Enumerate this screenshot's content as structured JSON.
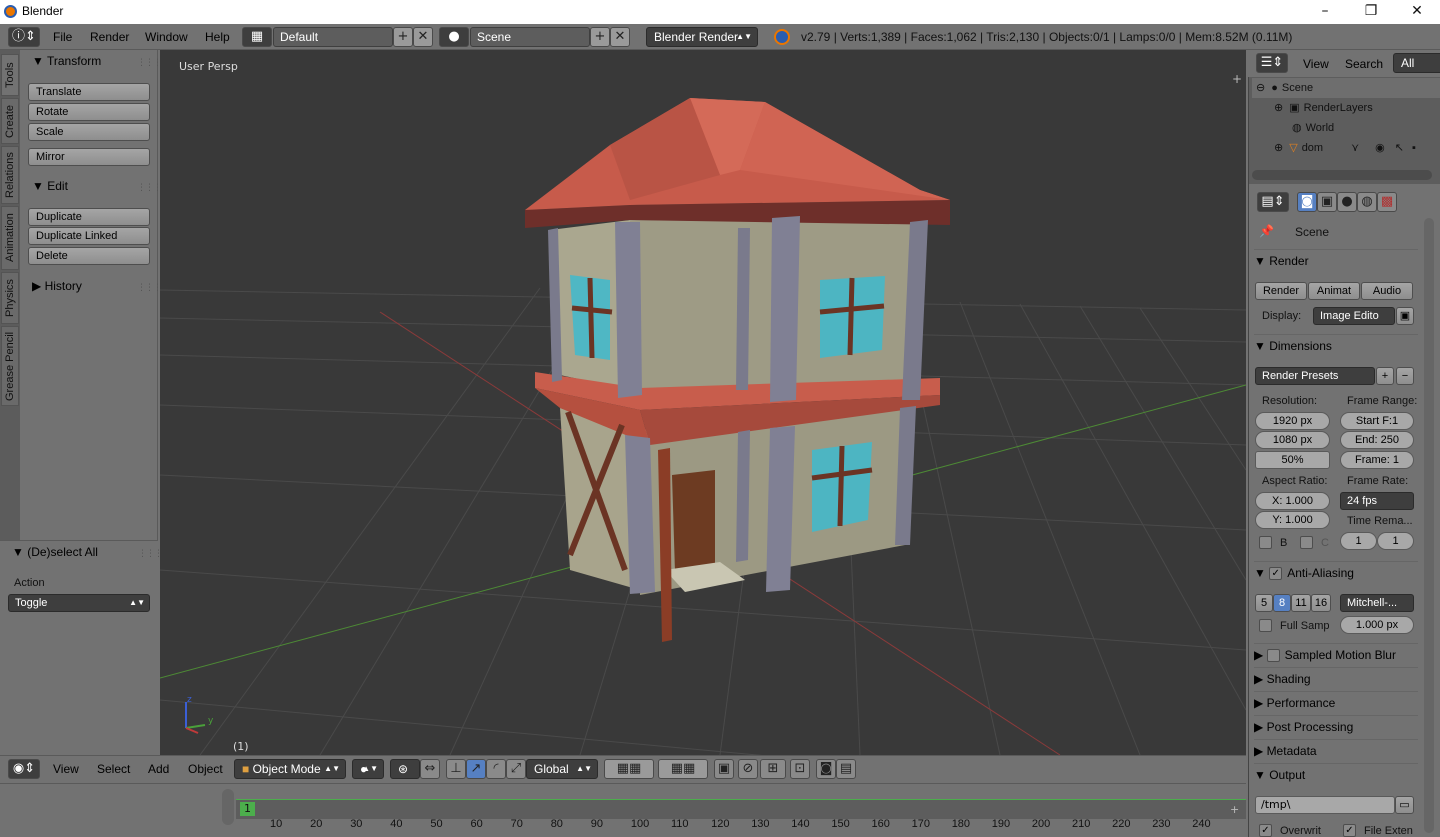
{
  "window": {
    "title": "Blender",
    "minimize": "–",
    "maximize": "❐",
    "close": "✕"
  },
  "menu": {
    "file": "File",
    "render": "Render",
    "window": "Window",
    "help": "Help"
  },
  "screen_layout": "Default",
  "scene_name": "Scene",
  "render_engine": "Blender Render",
  "stats": "v2.79 | Verts:1,389 | Faces:1,062 | Tris:2,130 | Objects:0/1 | Lamps:0/0 | Mem:8.52M (0.11M)",
  "shelf_tabs": [
    "Tools",
    "Create",
    "Relations",
    "Animation",
    "Physics",
    "Grease Pencil"
  ],
  "transform": {
    "header": "Transform",
    "translate": "Translate",
    "rotate": "Rotate",
    "scale": "Scale",
    "mirror": "Mirror"
  },
  "edit": {
    "header": "Edit",
    "duplicate": "Duplicate",
    "duplicate_linked": "Duplicate Linked",
    "delete": "Delete"
  },
  "history": {
    "header": "History"
  },
  "operator": {
    "header": "(De)select All",
    "action_label": "Action",
    "action_value": "Toggle"
  },
  "viewport": {
    "label": "User Persp",
    "frame": "(1)",
    "axis_x": "x",
    "axis_y": "y",
    "axis_z": "z"
  },
  "view_header": {
    "view": "View",
    "select": "Select",
    "add": "Add",
    "object": "Object",
    "mode": "Object Mode",
    "orientation": "Global"
  },
  "timeline": {
    "current": "1",
    "ticks": [
      "10",
      "20",
      "30",
      "40",
      "50",
      "60",
      "70",
      "80",
      "90",
      "100",
      "110",
      "120",
      "130",
      "140",
      "150",
      "160",
      "170",
      "180",
      "190",
      "200",
      "210",
      "220",
      "230",
      "240"
    ]
  },
  "outliner": {
    "view": "View",
    "search": "Search",
    "filter": "All Scen",
    "items": [
      "Scene",
      "RenderLayers",
      "World",
      "dom"
    ]
  },
  "properties": {
    "scene": "Scene",
    "render_header": "Render",
    "render_btn": "Render",
    "anim_btn": "Animat",
    "audio_btn": "Audio",
    "display_label": "Display:",
    "display_value": "Image Edito",
    "dimensions": "Dimensions",
    "presets": "Render Presets",
    "resolution_label": "Resolution:",
    "res_x": "1920 px",
    "res_y": "1080 px",
    "res_pct": "50%",
    "frame_range_label": "Frame Range:",
    "start": "Start F:1",
    "end": "End: 250",
    "frame": "Frame: 1",
    "aspect_label": "Aspect Ratio:",
    "aspect_x": "X: 1.000",
    "aspect_y": "Y: 1.000",
    "frame_rate_label": "Frame Rate:",
    "fps": "24 fps",
    "time_remap": "Time Rema...",
    "remap_old": "1",
    "remap_new": "1",
    "border_b": "B",
    "border_c": "C",
    "anti_aliasing": "Anti-Aliasing",
    "aa_samples": [
      "5",
      "8",
      "11",
      "16"
    ],
    "filter": "Mitchell-...",
    "full_sample": "Full Samp",
    "filter_size": "1.000 px",
    "motion_blur": "Sampled Motion Blur",
    "shading": "Shading",
    "performance": "Performance",
    "post_processing": "Post Processing",
    "metadata": "Metadata",
    "output": "Output",
    "output_path": "/tmp\\",
    "overwrite": "Overwrit",
    "file_ext": "File Exten"
  },
  "colors": {
    "viewport_bg": "#393939",
    "ui_gray": "#727272",
    "roof": "#c35a4a",
    "wall": "#a6a38a",
    "window_glass": "#4ab7c4",
    "timber": "#6b3424",
    "stone": "#7a7a8a"
  }
}
